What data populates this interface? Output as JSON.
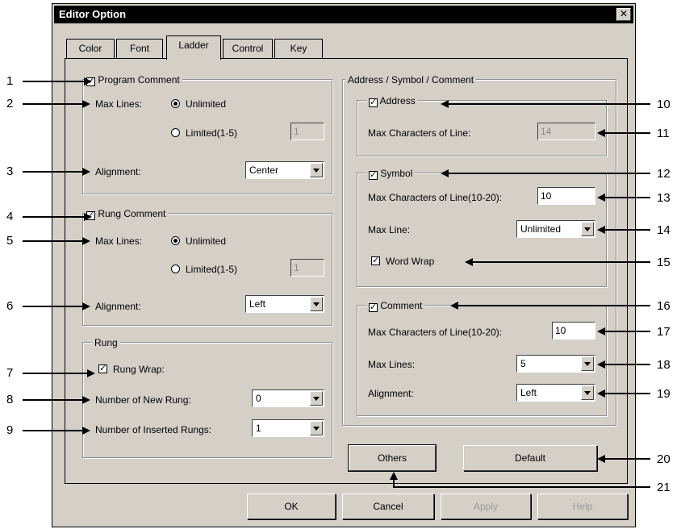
{
  "window": {
    "title": "Editor Option",
    "close_glyph": "✕"
  },
  "tabs": [
    "Color",
    "Font",
    "Ladder",
    "Control",
    "Key"
  ],
  "program_comment": {
    "label": "Program Comment",
    "max_lines_label": "Max Lines:",
    "unlimited_label": "Unlimited",
    "limited_label": "Limited(1-5)",
    "limited_value": "1",
    "alignment_label": "Alignment:",
    "alignment_value": "Center"
  },
  "rung_comment": {
    "label": "Rung Comment",
    "max_lines_label": "Max Lines:",
    "unlimited_label": "Unlimited",
    "limited_label": "Limited(1-5)",
    "limited_value": "1",
    "alignment_label": "Alignment:",
    "alignment_value": "Left"
  },
  "rung": {
    "label": "Rung",
    "wrap_label": "Rung Wrap:",
    "new_rung_label": "Number of New Rung:",
    "new_rung_value": "0",
    "inserted_label": "Number of Inserted Rungs:",
    "inserted_value": "1"
  },
  "asc": {
    "label": "Address / Symbol / Comment",
    "address_label": "Address",
    "address_max_label": "Max Characters of Line:",
    "address_max_value": "14",
    "symbol_label": "Symbol",
    "symbol_max_label": "Max Characters of Line(10-20):",
    "symbol_max_value": "10",
    "symbol_line_label": "Max Line:",
    "symbol_line_value": "Unlimited",
    "word_wrap_label": "Word Wrap",
    "comment_label": "Comment",
    "comment_max_label": "Max Characters of Line(10-20):",
    "comment_max_value": "10",
    "comment_lines_label": "Max Lines:",
    "comment_lines_value": "5",
    "comment_align_label": "Alignment:",
    "comment_align_value": "Left"
  },
  "buttons": {
    "others": "Others",
    "default": "Default",
    "ok": "OK",
    "cancel": "Cancel",
    "apply": "Apply",
    "help": "Help"
  },
  "check_glyph": "✓",
  "callouts": [
    "1",
    "2",
    "3",
    "4",
    "5",
    "6",
    "7",
    "8",
    "9",
    "10",
    "11",
    "12",
    "13",
    "14",
    "15",
    "16",
    "17",
    "18",
    "19",
    "20",
    "21"
  ]
}
